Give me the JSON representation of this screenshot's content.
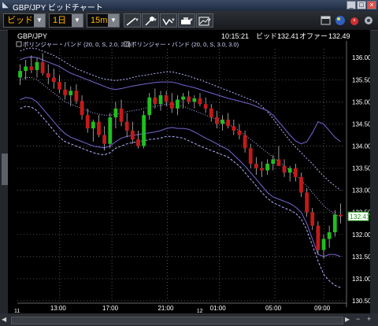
{
  "window": {
    "title": "GBP/JPY ビッドチャート",
    "controls": [
      "_",
      "□",
      "×"
    ]
  },
  "toolbar": {
    "price_type": "ビッド",
    "period": "1日",
    "interval": "15m"
  },
  "chart": {
    "symbol": "GBP/JPY",
    "info": {
      "time": "10:15:21",
      "bid_label": "ビッド :",
      "bid": "132.41",
      "offer_label": "オファー :",
      "offer": "132.49"
    },
    "legends": [
      "ボリンジャー・バンド (20, 0, S, 2.0, 2.0)",
      "ボリンジャー・バンド (20, 0, S, 3.0, 3.0)"
    ],
    "current_price_tag": "132.41",
    "y_ticks": [
      "136.00",
      "135.50",
      "135.00",
      "134.50",
      "134.00",
      "133.50",
      "133.00",
      "132.50",
      "132.00",
      "131.50",
      "131.00",
      "130.50"
    ],
    "x_ticks": [
      "13:00",
      "17:00",
      "21:00",
      "01:00",
      "05:00",
      "09:00"
    ],
    "day_labels": [
      "11",
      "12"
    ]
  },
  "colors": {
    "up_candle": "#1fbf1f",
    "down_candle": "#c31a1a",
    "band_2sd": "#7b64d4",
    "band_3sd": "#aeb4ff",
    "price_tag_bg": "#ffffff",
    "price_tag_text": "#1a9a1a",
    "grid": "#777777"
  },
  "chart_data": {
    "type": "candlestick",
    "y_range": [
      130.5,
      136.2
    ],
    "candles": [
      [
        135.55,
        135.85,
        135.38,
        135.7
      ],
      [
        135.7,
        135.95,
        135.5,
        135.8
      ],
      [
        135.8,
        136.05,
        135.65,
        135.72
      ],
      [
        135.72,
        136.0,
        135.55,
        135.9
      ],
      [
        135.9,
        136.1,
        135.6,
        135.65
      ],
      [
        135.65,
        135.85,
        135.4,
        135.55
      ],
      [
        135.55,
        135.75,
        135.3,
        135.45
      ],
      [
        135.45,
        135.6,
        135.2,
        135.28
      ],
      [
        135.28,
        135.45,
        135.05,
        135.15
      ],
      [
        135.15,
        135.35,
        134.9,
        135.25
      ],
      [
        135.25,
        135.4,
        134.95,
        135.02
      ],
      [
        135.02,
        135.15,
        134.6,
        134.7
      ],
      [
        134.7,
        134.85,
        134.3,
        134.4
      ],
      [
        134.4,
        134.6,
        134.1,
        134.55
      ],
      [
        134.55,
        134.7,
        134.2,
        134.25
      ],
      [
        134.25,
        134.45,
        133.9,
        134.05
      ],
      [
        134.05,
        134.75,
        133.95,
        134.65
      ],
      [
        134.65,
        135.0,
        134.4,
        134.85
      ],
      [
        134.85,
        135.05,
        134.45,
        134.55
      ],
      [
        134.55,
        134.75,
        134.2,
        134.35
      ],
      [
        134.35,
        134.55,
        134.05,
        134.15
      ],
      [
        134.15,
        134.35,
        133.95,
        134.0
      ],
      [
        134.0,
        134.8,
        133.95,
        134.7
      ],
      [
        134.7,
        135.2,
        134.6,
        135.1
      ],
      [
        135.1,
        135.3,
        134.85,
        134.95
      ],
      [
        134.95,
        135.25,
        134.8,
        135.15
      ],
      [
        135.15,
        135.25,
        134.9,
        135.0
      ],
      [
        135.0,
        135.2,
        134.75,
        134.85
      ],
      [
        134.85,
        135.15,
        134.7,
        135.05
      ],
      [
        135.05,
        135.2,
        134.85,
        135.12
      ],
      [
        135.12,
        135.25,
        134.95,
        135.0
      ],
      [
        135.0,
        135.15,
        134.85,
        135.08
      ],
      [
        135.08,
        135.2,
        134.9,
        134.95
      ],
      [
        134.95,
        135.1,
        134.75,
        134.85
      ],
      [
        134.85,
        134.95,
        134.55,
        134.65
      ],
      [
        134.65,
        134.8,
        134.4,
        134.5
      ],
      [
        134.5,
        134.7,
        134.35,
        134.6
      ],
      [
        134.6,
        134.75,
        134.4,
        134.45
      ],
      [
        134.45,
        134.6,
        134.25,
        134.35
      ],
      [
        134.35,
        134.5,
        134.15,
        134.25
      ],
      [
        134.25,
        134.35,
        133.85,
        133.95
      ],
      [
        133.95,
        134.05,
        133.5,
        133.6
      ],
      [
        133.6,
        133.75,
        133.35,
        133.5
      ],
      [
        133.5,
        133.65,
        133.3,
        133.45
      ],
      [
        133.45,
        133.7,
        133.35,
        133.6
      ],
      [
        133.6,
        133.8,
        133.45,
        133.7
      ],
      [
        133.7,
        134.0,
        133.55,
        133.55
      ],
      [
        133.55,
        133.7,
        133.3,
        133.4
      ],
      [
        133.4,
        133.55,
        133.2,
        133.5
      ],
      [
        133.5,
        133.6,
        133.2,
        133.3
      ],
      [
        133.3,
        133.4,
        132.85,
        132.95
      ],
      [
        132.95,
        133.05,
        132.4,
        132.5
      ],
      [
        132.5,
        132.6,
        132.1,
        132.2
      ],
      [
        132.2,
        132.3,
        131.55,
        131.65
      ],
      [
        131.65,
        132.0,
        131.45,
        131.9
      ],
      [
        131.9,
        132.2,
        131.7,
        132.05
      ],
      [
        132.05,
        132.55,
        131.95,
        132.45
      ],
      [
        132.45,
        132.7,
        132.25,
        132.41
      ]
    ],
    "bands": {
      "mid": [
        135.5,
        135.55,
        135.55,
        135.5,
        135.4,
        135.3,
        135.2,
        135.1,
        135.0,
        134.95,
        134.9,
        134.85,
        134.8,
        134.75,
        134.72,
        134.7,
        134.7,
        134.72,
        134.75,
        134.78,
        134.8,
        134.82,
        134.85,
        134.88,
        134.9,
        134.92,
        134.95,
        134.95,
        134.92,
        134.9,
        134.85,
        134.8,
        134.75,
        134.7,
        134.65,
        134.6,
        134.55,
        134.5,
        134.42,
        134.35,
        134.25,
        134.15,
        134.05,
        133.95,
        133.85,
        133.75,
        133.65,
        133.55,
        133.45,
        133.35,
        133.22,
        133.1,
        132.95,
        132.8,
        132.65,
        132.55,
        132.45,
        132.4
      ],
      "up2": [
        135.95,
        136.0,
        136.02,
        136.0,
        135.95,
        135.9,
        135.85,
        135.8,
        135.72,
        135.65,
        135.6,
        135.55,
        135.5,
        135.45,
        135.4,
        135.35,
        135.3,
        135.28,
        135.3,
        135.33,
        135.36,
        135.38,
        135.4,
        135.42,
        135.44,
        135.45,
        135.45,
        135.45,
        135.42,
        135.38,
        135.35,
        135.32,
        135.28,
        135.24,
        135.2,
        135.16,
        135.12,
        135.08,
        135.05,
        135.02,
        134.98,
        134.95,
        134.9,
        134.85,
        134.8,
        134.7,
        134.55,
        134.4,
        134.25,
        134.12,
        134.05,
        134.1,
        134.3,
        134.55,
        134.5,
        134.35,
        134.2,
        134.1
      ],
      "low2": [
        135.05,
        135.1,
        135.08,
        135.0,
        134.85,
        134.7,
        134.55,
        134.4,
        134.28,
        134.2,
        134.15,
        134.1,
        134.05,
        134.0,
        133.98,
        133.96,
        134.0,
        134.1,
        134.18,
        134.22,
        134.24,
        134.26,
        134.28,
        134.3,
        134.32,
        134.35,
        134.4,
        134.42,
        134.4,
        134.4,
        134.38,
        134.32,
        134.25,
        134.18,
        134.12,
        134.05,
        133.98,
        133.92,
        133.8,
        133.68,
        133.55,
        133.4,
        133.25,
        133.1,
        132.95,
        132.85,
        132.8,
        132.75,
        132.7,
        132.62,
        132.5,
        132.25,
        131.9,
        131.55,
        131.5,
        131.55,
        131.55,
        131.5
      ],
      "up3": [
        136.15,
        136.2,
        136.22,
        136.2,
        136.15,
        136.1,
        136.05,
        135.98,
        135.9,
        135.82,
        135.75,
        135.7,
        135.65,
        135.6,
        135.55,
        135.52,
        135.5,
        135.48,
        135.5,
        135.52,
        135.55,
        135.58,
        135.6,
        135.62,
        135.64,
        135.66,
        135.68,
        135.68,
        135.65,
        135.62,
        135.58,
        135.54,
        135.5,
        135.45,
        135.4,
        135.35,
        135.3,
        135.25,
        135.2,
        135.15,
        135.1,
        135.05,
        135.0,
        134.9,
        134.78,
        134.62,
        134.45,
        134.28,
        134.12,
        133.98,
        133.85,
        133.72,
        133.6,
        133.45,
        133.32,
        133.2,
        133.1,
        133.0
      ],
      "low3": [
        134.85,
        134.9,
        134.88,
        134.8,
        134.65,
        134.5,
        134.35,
        134.2,
        134.1,
        134.05,
        134.0,
        133.95,
        133.9,
        133.85,
        133.82,
        133.8,
        133.85,
        133.95,
        134.0,
        134.05,
        134.08,
        134.1,
        134.12,
        134.15,
        134.16,
        134.18,
        134.22,
        134.22,
        134.2,
        134.18,
        134.12,
        134.06,
        134.0,
        133.95,
        133.9,
        133.85,
        133.8,
        133.75,
        133.65,
        133.55,
        133.4,
        133.25,
        133.1,
        132.95,
        132.82,
        132.72,
        132.66,
        132.6,
        132.55,
        132.48,
        132.35,
        132.1,
        131.75,
        131.4,
        131.1,
        130.95,
        130.85,
        130.8
      ]
    }
  }
}
